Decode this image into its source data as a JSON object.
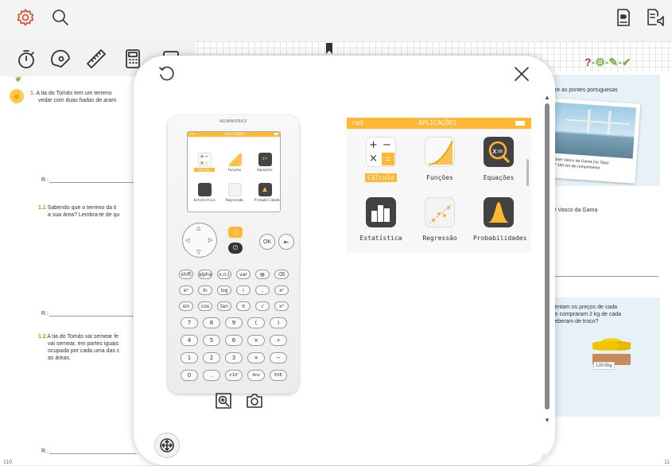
{
  "topbar": {
    "settings": "gear-icon",
    "search": "search-icon",
    "doc": "document-icon",
    "audio": "read-aloud-icon"
  },
  "toolbar": {
    "tools": [
      "timer-icon",
      "protractor-icon",
      "ruler-icon",
      "calculator-icon",
      "whiteboard-icon"
    ]
  },
  "book": {
    "page_left": "110",
    "page_right": "11",
    "ex1_num": "1.",
    "ex1_text_1": "A tia do Tomás tem um terreno",
    "ex1_text_2": "vedar com duas fiadas de aram",
    "ans": "R.:",
    "ex11_num": "1.1",
    "ex11_text_1": "Sabendo que o terreno da ti",
    "ex11_text_2": "a sua área? Lembra-te de qu",
    "ex12_num": "1.2",
    "ex12_text_1": "A tia do Tomás vai semear fe",
    "ex12_text_2": "vai semear, em partes iguais",
    "ex12_text_3": "ocupada por cada uma das c",
    "ex12_text_4": "as áreas.",
    "right_1": "obre as pontes portuguesas",
    "photo_caption_1": "Ponte Vasco da Gama (rio Tejo)",
    "photo_caption_2": "17 185 km de comprimento",
    "right_2": "nte Vasco da Gama",
    "right_3_1": "esentam os preços de cada",
    "right_3_2": "que compraram 2 kg de cada",
    "right_3_3": "eceberam de troco?",
    "price": "1,09 €/kg",
    "colors": {
      "accent": "#c79200",
      "check": "#7cb342",
      "question": "#d32f2f"
    }
  },
  "overlay": {
    "reset_icon": "rotate-icon",
    "close_icon": "close-icon",
    "move_icon": "move-icon",
    "calc_brand": "NUMWORKS",
    "zoom_icon": "zoom-icon",
    "camera_icon": "camera-icon",
    "screen": {
      "mode": "rad",
      "title": "APLICAÇÕES",
      "apps": [
        {
          "label": "Cálculo",
          "selected": true
        },
        {
          "label": "Funções",
          "selected": false
        },
        {
          "label": "Equações",
          "selected": false
        },
        {
          "label": "Estatística",
          "selected": false
        },
        {
          "label": "Regressão",
          "selected": false
        },
        {
          "label": "Probabilidades",
          "selected": false
        }
      ]
    },
    "keys": {
      "ok": "OK",
      "back": "⇤",
      "home": "⌂",
      "power": "⏻",
      "row1": [
        "shift",
        "alpha",
        "x,n,t",
        "var",
        "▤",
        "⌫"
      ],
      "row2": [
        "eˣ",
        "ln",
        "log",
        "i",
        ",",
        "xʸ"
      ],
      "row3": [
        "sin",
        "cos",
        "tan",
        "π",
        "√",
        "x²"
      ],
      "row4": [
        "7",
        "8",
        "9",
        "(",
        ")"
      ],
      "row5": [
        "4",
        "5",
        "6",
        "×",
        "÷"
      ],
      "row6": [
        "1",
        "2",
        "3",
        "+",
        "−"
      ],
      "row7": [
        "0",
        ".",
        "×10ˣ",
        "Ans",
        "EXE"
      ]
    },
    "accent": "#ffb734"
  }
}
